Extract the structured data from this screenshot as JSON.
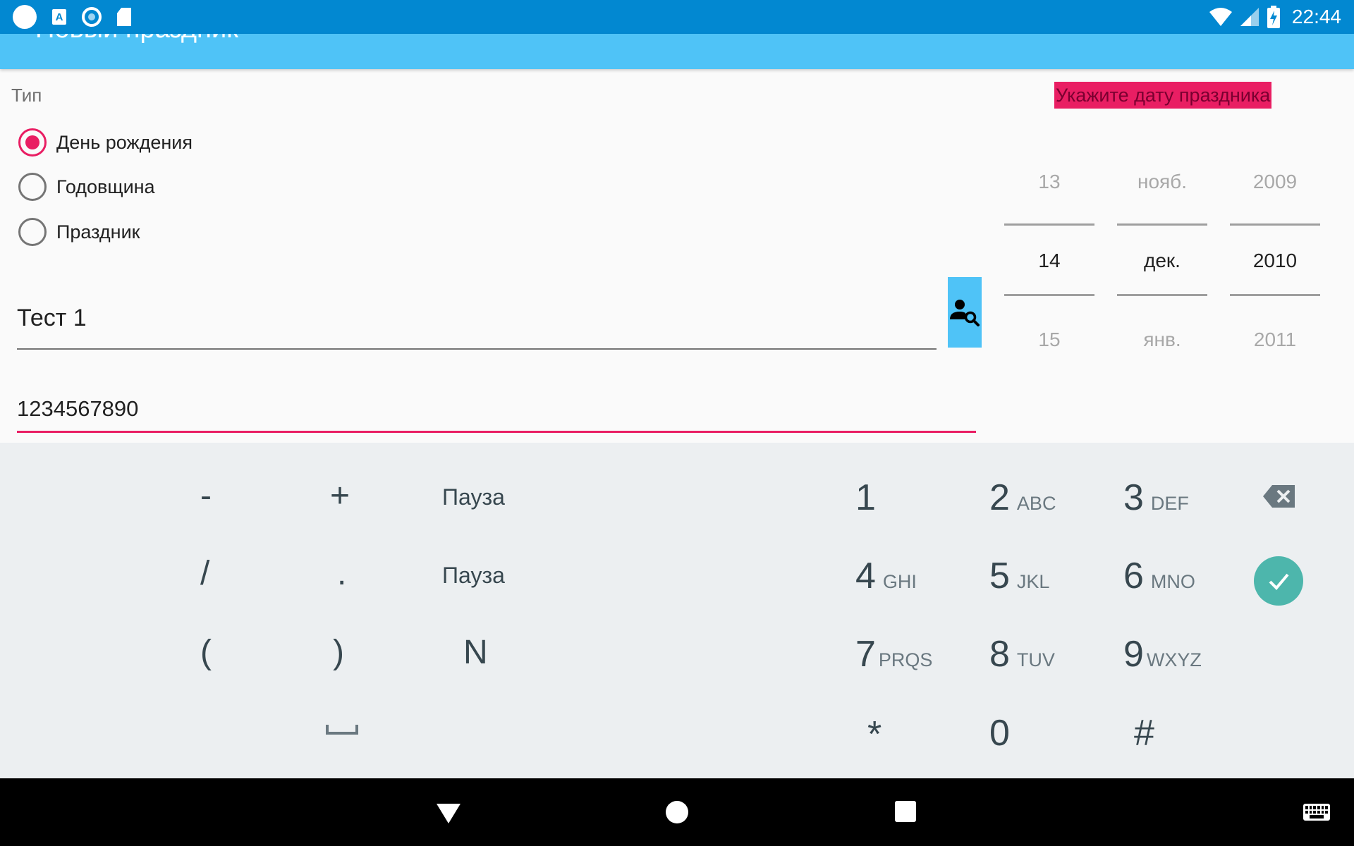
{
  "status_bar": {
    "time": "22:44",
    "left_icons": [
      "circle-notification-icon",
      "font-a-icon",
      "ring-notification-icon",
      "sd-card-icon"
    ],
    "right_icons": [
      "wifi-icon",
      "cell-signal-icon",
      "battery-charging-icon"
    ],
    "a_glyph": "A"
  },
  "app_bar": {
    "title": "Новый праздник"
  },
  "form": {
    "type_label": "Тип",
    "types": [
      {
        "label": "День рождения",
        "checked": true
      },
      {
        "label": "Годовщина",
        "checked": false
      },
      {
        "label": "Праздник",
        "checked": false
      }
    ],
    "name_value": "Тест 1",
    "phone_value": "1234567890"
  },
  "date_hint": "Укажите дату праздника",
  "date_picker": {
    "day": {
      "prev": "13",
      "selected": "14",
      "next": "15"
    },
    "month": {
      "prev": "нояб.",
      "selected": "дек.",
      "next": "янв."
    },
    "year": {
      "prev": "2009",
      "selected": "2010",
      "next": "2011"
    }
  },
  "keyboard": {
    "left_keys": [
      "-",
      "+",
      "Пауза",
      "/",
      ".",
      "Пауза",
      "(",
      ")",
      "N"
    ],
    "digits": [
      {
        "d": "1",
        "l": ""
      },
      {
        "d": "2",
        "l": "ABC"
      },
      {
        "d": "3",
        "l": "DEF"
      },
      {
        "d": "4",
        "l": "GHI"
      },
      {
        "d": "5",
        "l": "JKL"
      },
      {
        "d": "6",
        "l": "MNO"
      },
      {
        "d": "7",
        "l": "PRQS"
      },
      {
        "d": "8",
        "l": "TUV"
      },
      {
        "d": "9",
        "l": "WXYZ"
      },
      {
        "d": "*",
        "l": ""
      },
      {
        "d": "0",
        "l": ""
      },
      {
        "d": "#",
        "l": ""
      }
    ],
    "accent_color": "#4db6ac"
  },
  "colors": {
    "status_bar": "#0288d1",
    "app_bar": "#4fc3f7",
    "accent": "#e91e63"
  }
}
